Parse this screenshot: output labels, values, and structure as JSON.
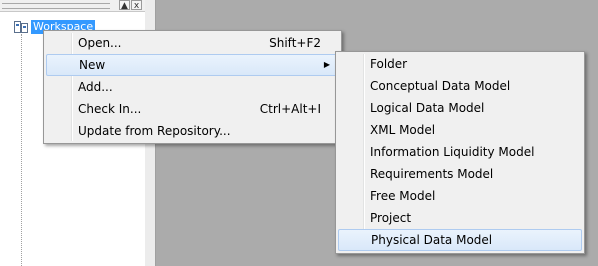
{
  "tree": {
    "root_label": "Workspace",
    "toolbar_close": "x",
    "toolbar_arrow": "▲"
  },
  "context_menu": {
    "items": [
      {
        "label": "Open...",
        "shortcut": "Shift+F2"
      },
      {
        "label": "New",
        "shortcut": "",
        "submenu_arrow": "▶"
      },
      {
        "label": "Add...",
        "shortcut": ""
      },
      {
        "label": "Check In...",
        "shortcut": "Ctrl+Alt+I"
      },
      {
        "label": "Update from Repository...",
        "shortcut": ""
      }
    ]
  },
  "new_submenu": {
    "items": [
      {
        "label": "Folder"
      },
      {
        "label": "Conceptual Data Model"
      },
      {
        "label": "Logical Data Model"
      },
      {
        "label": "XML Model"
      },
      {
        "label": "Information Liquidity Model"
      },
      {
        "label": "Requirements Model"
      },
      {
        "label": "Free Model"
      },
      {
        "label": "Project"
      },
      {
        "label": "Physical Data Model"
      }
    ]
  },
  "colors": {
    "selection": "#3399ff",
    "menu_bg": "#f0f0f0",
    "highlight_border": "#aecbf0",
    "desktop": "#ababab"
  }
}
